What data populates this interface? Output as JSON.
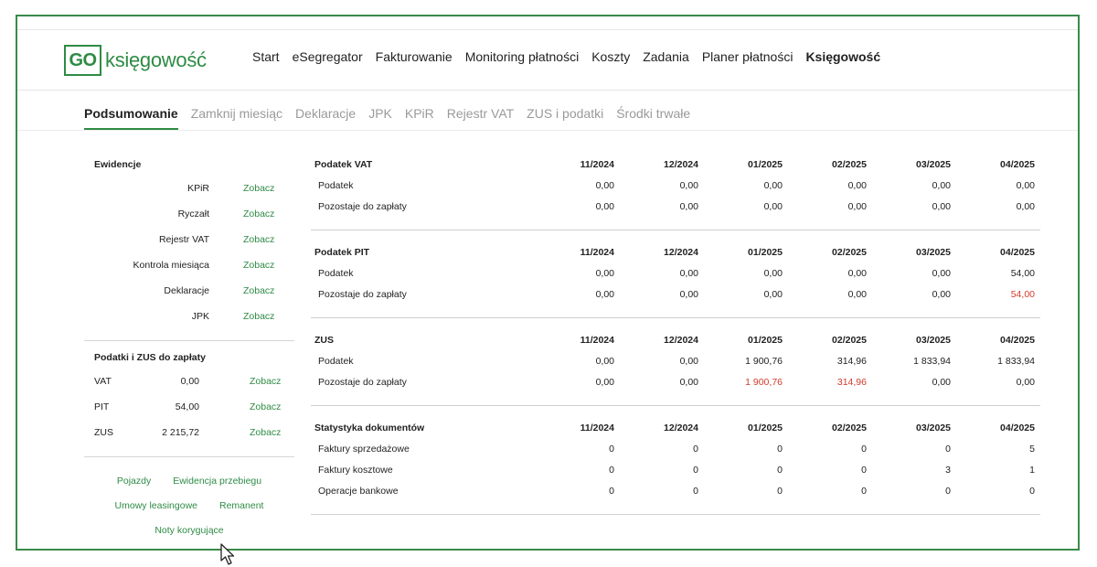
{
  "brand": {
    "logo_box": "GO",
    "logo_text": "księgowość",
    "color": "#2e8b45"
  },
  "main_nav": [
    {
      "label": "Start"
    },
    {
      "label": "eSegregator"
    },
    {
      "label": "Fakturowanie"
    },
    {
      "label": "Monitoring płatności"
    },
    {
      "label": "Koszty"
    },
    {
      "label": "Zadania"
    },
    {
      "label": "Planer płatności"
    },
    {
      "label": "Księgowość",
      "active": true
    }
  ],
  "sub_nav": [
    {
      "label": "Podsumowanie",
      "active": true
    },
    {
      "label": "Zamknij miesiąc"
    },
    {
      "label": "Deklaracje"
    },
    {
      "label": "JPK"
    },
    {
      "label": "KPiR"
    },
    {
      "label": "Rejestr VAT"
    },
    {
      "label": "ZUS i podatki"
    },
    {
      "label": "Środki trwałe"
    }
  ],
  "ewidencje": {
    "title": "Ewidencje",
    "link_label": "Zobacz",
    "items": [
      "KPiR",
      "Ryczałt",
      "Rejestr VAT",
      "Kontrola miesiąca",
      "Deklaracje",
      "JPK"
    ]
  },
  "podatki": {
    "title": "Podatki i ZUS do zapłaty",
    "link_label": "Zobacz",
    "items": [
      {
        "name": "VAT",
        "value": "0,00"
      },
      {
        "name": "PIT",
        "value": "54,00"
      },
      {
        "name": "ZUS",
        "value": "2 215,72"
      }
    ]
  },
  "extra_links": {
    "row1": [
      "Pojazdy",
      "Ewidencja przebiegu"
    ],
    "row2": [
      "Umowy leasingowe",
      "Remanent"
    ],
    "row3": [
      "Noty korygujące"
    ]
  },
  "periods": [
    "11/2024",
    "12/2024",
    "01/2025",
    "02/2025",
    "03/2025",
    "04/2025"
  ],
  "tables": [
    {
      "title": "Podatek VAT",
      "rows": [
        {
          "label": "Podatek",
          "values": [
            "0,00",
            "0,00",
            "0,00",
            "0,00",
            "0,00",
            "0,00"
          ]
        },
        {
          "label": "Pozostaje do zapłaty",
          "values": [
            "0,00",
            "0,00",
            "0,00",
            "0,00",
            "0,00",
            "0,00"
          ]
        }
      ]
    },
    {
      "title": "Podatek PIT",
      "rows": [
        {
          "label": "Podatek",
          "values": [
            "0,00",
            "0,00",
            "0,00",
            "0,00",
            "0,00",
            "54,00"
          ]
        },
        {
          "label": "Pozostaje do zapłaty",
          "values": [
            "0,00",
            "0,00",
            "0,00",
            "0,00",
            "0,00",
            "54,00"
          ],
          "red": [
            5
          ]
        }
      ]
    },
    {
      "title": "ZUS",
      "rows": [
        {
          "label": "Podatek",
          "values": [
            "0,00",
            "0,00",
            "1 900,76",
            "314,96",
            "1 833,94",
            "1 833,94"
          ]
        },
        {
          "label": "Pozostaje do zapłaty",
          "values": [
            "0,00",
            "0,00",
            "1 900,76",
            "314,96",
            "0,00",
            "0,00"
          ],
          "red": [
            2,
            3
          ]
        }
      ]
    },
    {
      "title": "Statystyka dokumentów",
      "rows": [
        {
          "label": "Faktury sprzedażowe",
          "values": [
            "0",
            "0",
            "0",
            "0",
            "0",
            "5"
          ]
        },
        {
          "label": "Faktury kosztowe",
          "values": [
            "0",
            "0",
            "0",
            "0",
            "3",
            "1"
          ]
        },
        {
          "label": "Operacje bankowe",
          "values": [
            "0",
            "0",
            "0",
            "0",
            "0",
            "0"
          ]
        }
      ]
    }
  ],
  "colors": {
    "accent": "#2e8b45",
    "alert": "#d23b2b",
    "frame": "#3a8a4a"
  }
}
